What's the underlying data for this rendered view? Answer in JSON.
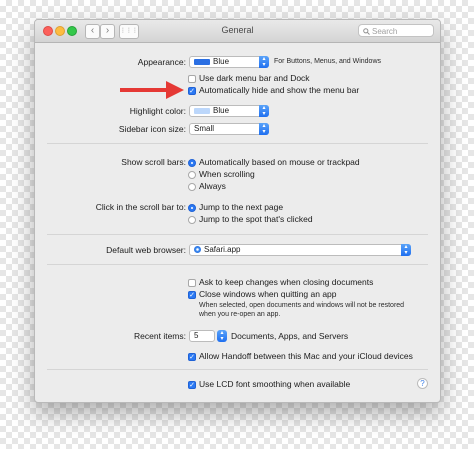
{
  "window": {
    "title": "General",
    "search_placeholder": "Search",
    "back_glyph": "‹",
    "forward_glyph": "›",
    "grid_glyph": "⋮⋮⋮"
  },
  "appearance": {
    "label": "Appearance:",
    "value": "Blue",
    "note": "For Buttons, Menus, and Windows",
    "swatch_color": "#2b6fe3"
  },
  "menu_bar_options": [
    {
      "label": "Use dark menu bar and Dock",
      "checked": false
    },
    {
      "label": "Automatically hide and show the menu bar",
      "checked": true
    }
  ],
  "highlight": {
    "label": "Highlight color:",
    "value": "Blue",
    "swatch_color": "#bcd7fb"
  },
  "sidebar": {
    "label": "Sidebar icon size:",
    "value": "Small"
  },
  "scroll_bars": {
    "label": "Show scroll bars:",
    "options": [
      {
        "label": "Automatically based on mouse or trackpad",
        "selected": true
      },
      {
        "label": "When scrolling",
        "selected": false
      },
      {
        "label": "Always",
        "selected": false
      }
    ]
  },
  "click_scroll": {
    "label": "Click in the scroll bar to:",
    "options": [
      {
        "label": "Jump to the next page",
        "selected": true
      },
      {
        "label": "Jump to the spot that's clicked",
        "selected": false
      }
    ]
  },
  "browser": {
    "label": "Default web browser:",
    "value": "Safari.app"
  },
  "documents": {
    "ask_label": "Ask to keep changes when closing documents",
    "ask_checked": false,
    "close_label": "Close windows when quitting an app",
    "close_checked": true,
    "close_note_line1": "When selected, open documents and windows will not be restored",
    "close_note_line2": "when you re-open an app."
  },
  "recent": {
    "label": "Recent items:",
    "value": "5",
    "suffix": "Documents, Apps, and Servers"
  },
  "handoff": {
    "label": "Allow Handoff between this Mac and your iCloud devices",
    "checked": true
  },
  "lcd": {
    "label": "Use LCD font smoothing when available",
    "checked": true
  },
  "help_glyph": "?",
  "check_glyph": "✓",
  "colors": {
    "accent": "#2b79f3",
    "arrow": "#e53935"
  }
}
